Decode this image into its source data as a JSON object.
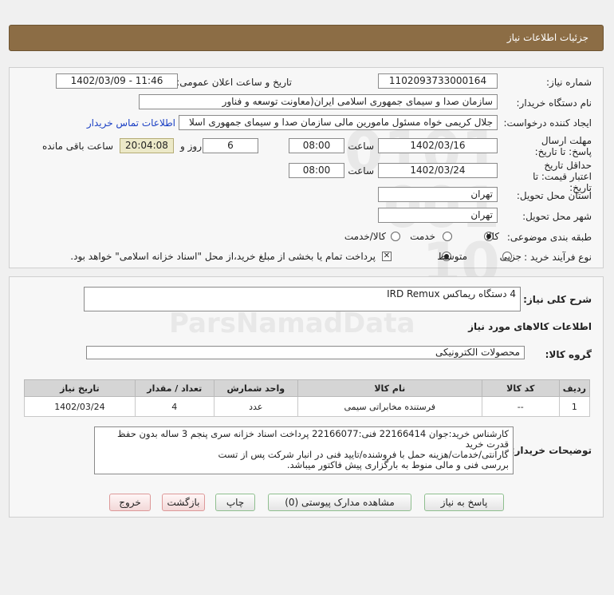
{
  "header": {
    "title": "جزئیات اطلاعات نیاز"
  },
  "form": {
    "need_number_label": "شماره نیاز:",
    "need_number": "1102093733000164",
    "announce_label": "تاریخ و ساعت اعلان عمومی:",
    "announce_value": "1402/03/09 - 11:46",
    "buyer_org_label": "نام دستگاه خریدار:",
    "buyer_org": "سازمان صدا و سیمای جمهوری اسلامی ایران(معاونت توسعه و فناور",
    "creator_label": "ایجاد کننده درخواست:",
    "creator": "جلال کریمی خواه مسئول مامورین مالی  سازمان صدا و سیمای جمهوری اسلا",
    "contact_link": "اطلاعات تماس خریدار",
    "deadline_label": "مهلت ارسال پاسخ: تا تاریخ:",
    "deadline_date": "1402/03/16",
    "time_label": "ساعت",
    "deadline_time": "08:00",
    "days_value": "6",
    "days_label": "روز و",
    "remaining_time": "20:04:08",
    "remaining_label": "ساعت باقی مانده",
    "validity_label": "حداقل تاریخ اعتبار قیمت: تا تاریخ:",
    "validity_date": "1402/03/24",
    "validity_time": "08:00",
    "province_label": "استان محل تحویل:",
    "province": "تهران",
    "city_label": "شهر محل تحویل:",
    "city": "تهران",
    "category_label": "طبقه بندی موضوعی:",
    "category_options": [
      "کالا",
      "خدمت",
      "کالا/خدمت"
    ],
    "category_selected": "کالا",
    "process_label": "نوع فرآیند خرید :",
    "process_options": [
      "جزیی",
      "متوسط"
    ],
    "process_selected": "متوسط",
    "treasury_note": "پرداخت تمام یا بخشی از مبلغ خرید،از محل \"اسناد خزانه اسلامی\" خواهد بود.",
    "treasury_checked": true
  },
  "details": {
    "summary_label": "شرح کلی نیاز:",
    "summary_value": "4 دستگاه ریماکس  IRD Remux",
    "goods_info_title": "اطلاعات کالاهای مورد نیاز",
    "goods_group_label": "گروه کالا:",
    "goods_group_value": "محصولات الکترونیکی",
    "table": {
      "headers": [
        "ردیف",
        "کد کالا",
        "نام کالا",
        "واحد شمارش",
        "تعداد / مقدار",
        "تاریخ نیاز"
      ],
      "rows": [
        [
          "1",
          "--",
          "فرستنده مخابراتی سیمی",
          "عدد",
          "4",
          "1402/03/24"
        ]
      ]
    },
    "buyer_notes_label": "توضیحات خریدار:",
    "buyer_notes": [
      "کارشناس خرید:جوان 22166414  فنی:22166077  پرداخت اسناد خزانه سری پنجم 3 ساله بدون حفظ",
      "قدرت خرید",
      "گارانتی/خدمات/هزینه حمل با فروشنده/تایید فنی در انبار شرکت پس از تست",
      "بررسی فنی و مالی منوط به بارگزاری پیش فاکتور میباشد."
    ]
  },
  "buttons": {
    "respond": "پاسخ به نیاز",
    "attachments": "مشاهده مدارک پیوستی (0)",
    "print": "چاپ",
    "back": "بازگشت",
    "exit": "خروج"
  }
}
